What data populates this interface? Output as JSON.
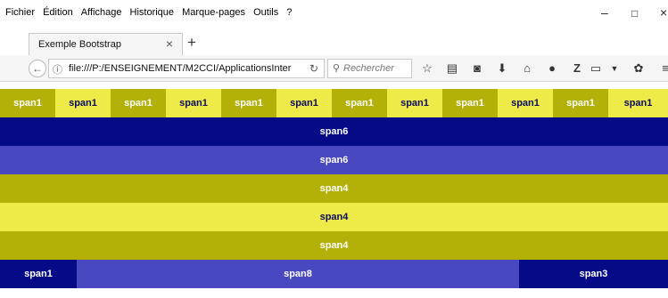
{
  "menubar": {
    "items": [
      "Fichier",
      "Édition",
      "Affichage",
      "Historique",
      "Marque-pages",
      "Outils",
      "?"
    ]
  },
  "window_controls": {
    "minimize": "–",
    "maximize": "□",
    "close": "×"
  },
  "tab": {
    "title": "Exemple Bootstrap",
    "close": "×"
  },
  "newtab": "+",
  "nav": {
    "url": "file:///P:/ENSEIGNEMENT/M2CCI/ApplicationsInter",
    "search_placeholder": "Rechercher"
  },
  "colors": {
    "olive": "#b3b008",
    "yellow": "#eeeb48",
    "navy": "#050b86",
    "blue": "#4a48c0"
  },
  "rows": {
    "r1": [
      "span1",
      "span1",
      "span1",
      "span1",
      "span1",
      "span1",
      "span1",
      "span1",
      "span1",
      "span1",
      "span1",
      "span1"
    ],
    "r2": "span6",
    "r3": "span6",
    "r4": "span4",
    "r5": "span4",
    "r6": "span4",
    "r7": [
      "span1",
      "span8",
      "span3"
    ]
  }
}
